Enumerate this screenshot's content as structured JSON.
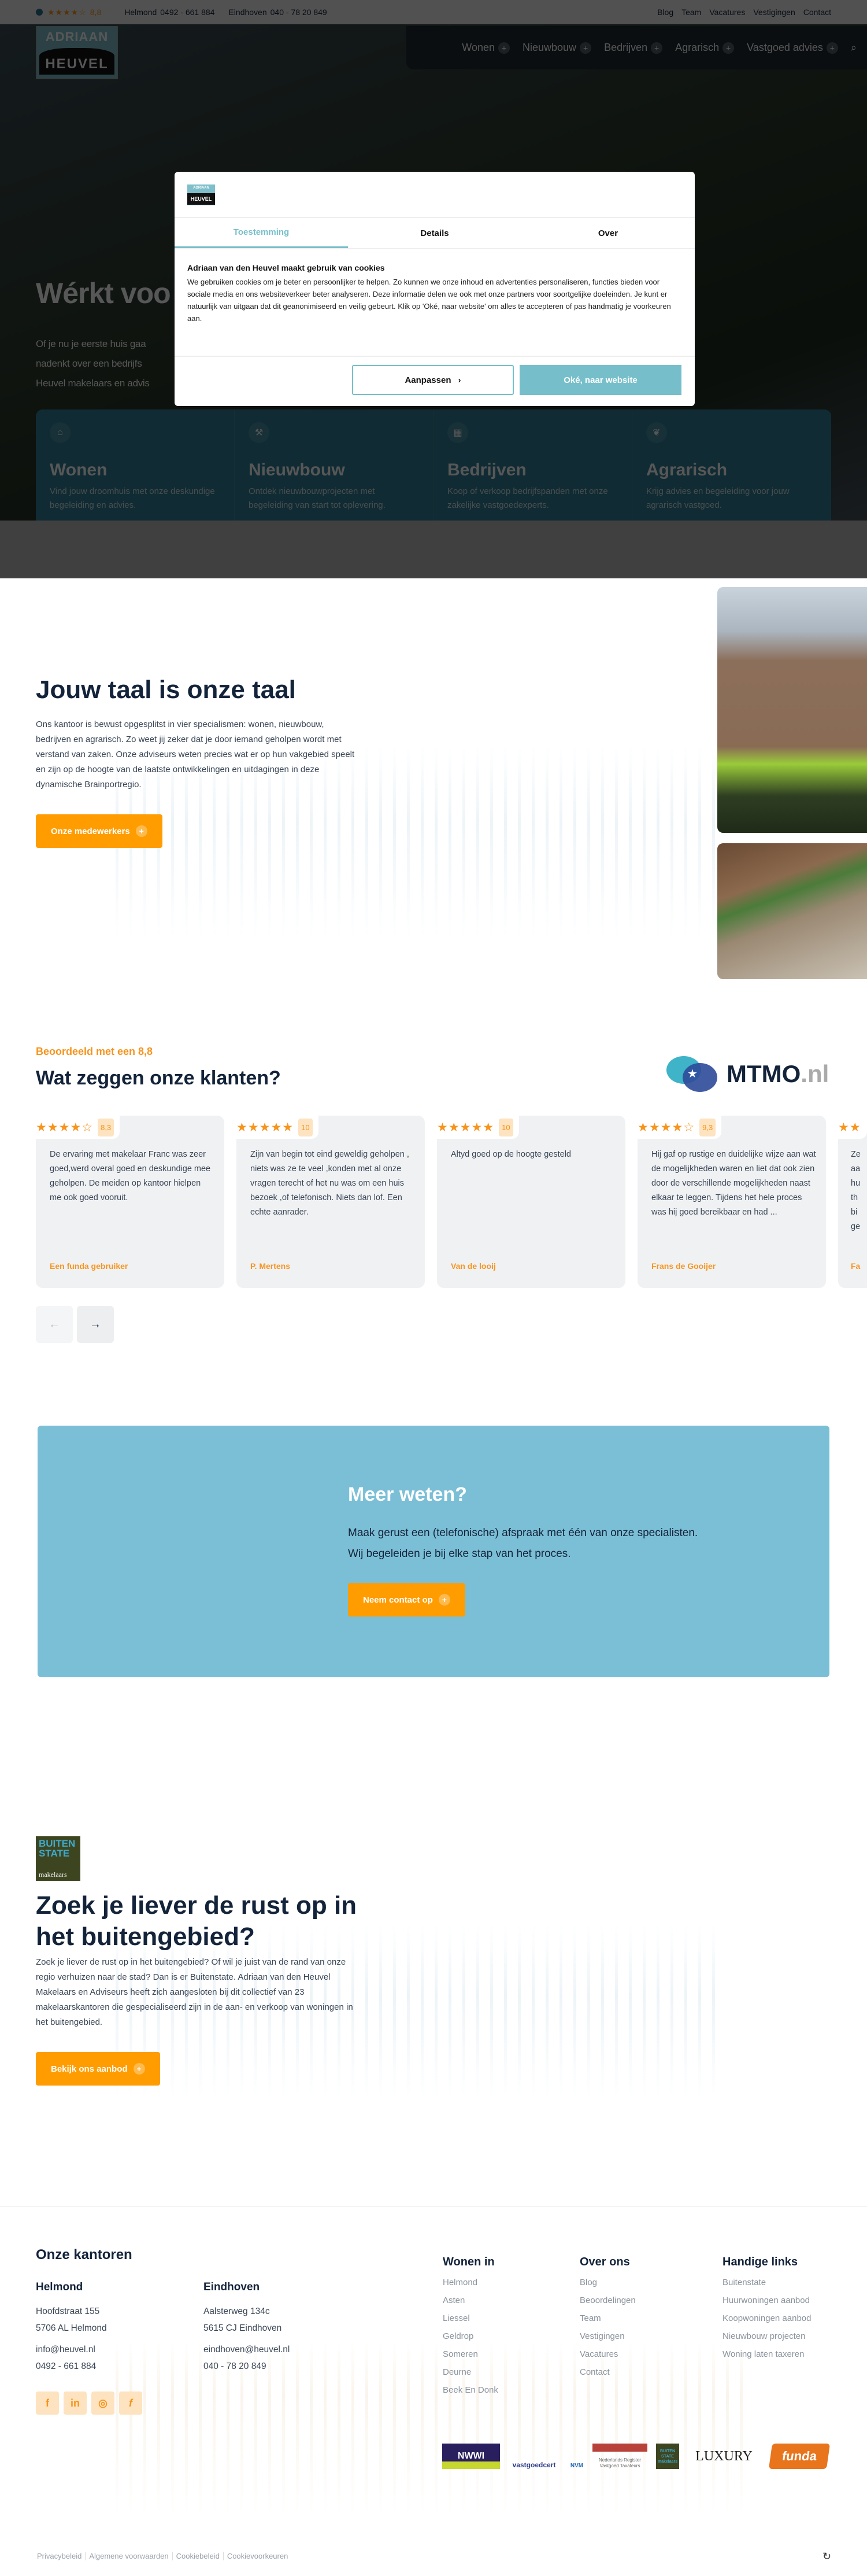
{
  "topbar": {
    "rating_stars": "★★★★☆",
    "rating_score": "8,8",
    "phones": [
      {
        "city": "Helmond",
        "number": "0492 - 661 884"
      },
      {
        "city": "Eindhoven",
        "number": "040 - 78 20 849"
      }
    ],
    "links": [
      "Blog",
      "Team",
      "Vacatures",
      "Vestigingen",
      "Contact"
    ]
  },
  "logo": {
    "top": "ADRIAAN",
    "bottom": "HEUVEL",
    "small": "VAN DEN"
  },
  "nav": {
    "items": [
      "Wonen",
      "Nieuwbouw",
      "Bedrijven",
      "Agrarisch",
      "Vastgoed advies"
    ],
    "plus": "+",
    "search_icon": "search-icon"
  },
  "hero": {
    "title_visible": "Wérkt voo",
    "text_lines_visible": [
      "Of je nu je eerste huis gaa",
      "nadenkt over een bedrijfs",
      "Heuvel makelaars en advis"
    ],
    "cards": [
      {
        "icon": "house-icon",
        "title": "Wonen",
        "text": "Vind jouw droomhuis met onze deskundige begeleiding en advies."
      },
      {
        "icon": "crane-icon",
        "title": "Nieuwbouw",
        "text": "Ontdek nieuwbouwprojecten met begeleiding van start tot oplevering."
      },
      {
        "icon": "office-icon",
        "title": "Bedrijven",
        "text": "Koop of verkoop bedrijfspanden met onze zakelijke vastgoedexperts."
      },
      {
        "icon": "leaf-icon",
        "title": "Agrarisch",
        "text": "Krijg advies en begeleiding voor jouw agrarisch vastgoed."
      }
    ]
  },
  "cookie_dialog": {
    "tabs": [
      "Toestemming",
      "Details",
      "Over"
    ],
    "active_tab": "Toestemming",
    "title": "Adriaan van den Heuvel maakt gebruik van cookies",
    "text": "We gebruiken cookies om je beter en persoonlijker te helpen. Zo kunnen we onze inhoud en advertenties personaliseren, functies bieden voor sociale media en ons websiteverkeer beter analyseren. Deze informatie delen we ook met onze partners voor soortgelijke doeleinden. Je kunt er natuurlijk van uitgaan dat dit geanonimiseerd en veilig gebeurt. Klik op 'Oké, naar website' om alles te accepteren of pas handmatig je voorkeuren aan.",
    "customize_label": "Aanpassen",
    "customize_chevron": "›",
    "accept_label": "Oké, naar website",
    "accent": "#76bfca"
  },
  "about": {
    "title": "Jouw taal is onze taal",
    "text": "Ons kantoor is bewust opgesplitst in vier specialismen: wonen, nieuwbouw, bedrijven en agrarisch. Zo weet jij zeker dat je door iemand geholpen wordt met verstand van zaken. Onze adviseurs weten precies wat er op hun vakgebied speelt en zijn op de hoogte van de laatste ontwikkelingen en uitdagingen in deze dynamische Brainportregio.",
    "button": "Onze medewerkers"
  },
  "reviews": {
    "eyebrow": "Beoordeeld met een 8,8",
    "title": "Wat zeggen onze klanten?",
    "provider": {
      "name": "MTMO",
      "suffix": ".nl"
    },
    "items": [
      {
        "stars": "★★★★☆",
        "score": "8,3",
        "text": "De ervaring met makelaar Franc was zeer goed,werd overal goed en deskundige mee geholpen. De meiden op kantoor hielpen me ook goed vooruit.",
        "author": "Een funda gebruiker"
      },
      {
        "stars": "★★★★★",
        "score": "10",
        "text": "Zijn van begin tot eind geweldig geholpen , niets was ze te veel ,konden met al onze vragen terecht of het nu was om een huis bezoek ,of telefonisch. Niets dan lof. Een echte aanrader.",
        "author": "P. Mertens"
      },
      {
        "stars": "★★★★★",
        "score": "10",
        "text": "Altyd goed op de hoogte gesteld",
        "author": "Van de looij"
      },
      {
        "stars": "★★★★☆",
        "score": "9,3",
        "text": "Hij gaf op rustige en duidelijke wijze aan wat de mogelijkheden waren en liet dat ook zien door de verschillende mogelijkheden naast elkaar te leggen. Tijdens het hele proces was hij goed bereikbaar en had ...",
        "author": "Frans de Gooijer"
      },
      {
        "stars": "★★",
        "score": "",
        "text": "Ze aa hu th bi ge",
        "author": "Fa"
      }
    ],
    "prev_icon": "←",
    "next_icon": "→",
    "star_color": "#f7941d"
  },
  "cta": {
    "title": "Meer weten?",
    "text_lines": [
      "Maak gerust een (telefonische) afspraak met één van onze specialisten.",
      "Wij begeleiden je bij elke stap van het proces."
    ],
    "button": "Neem contact op",
    "background": "#7bbfd7"
  },
  "buitenstate": {
    "logo": {
      "line1": "BUITEN",
      "line2": "STATE",
      "line3": "makelaars"
    },
    "title": "Zoek je liever de rust op in het buitengebied?",
    "text": "Zoek je liever de rust op in het buitengebied? Of wil je juist van de rand van onze regio verhuizen naar de stad? Dan is er Buitenstate. Adriaan van den Heuvel Makelaars en Adviseurs heeft zich aangesloten bij dit collectief van 23 makelaarskantoren die gespecialiseerd zijn in de aan- en verkoop van woningen in het buitengebied.",
    "button": "Bekijk ons aanbod"
  },
  "footer": {
    "offices_title": "Onze kantoren",
    "offices": [
      {
        "name": "Helmond",
        "street": "Hoofdstraat 155",
        "city": "5706 AL Helmond",
        "email": "info@heuvel.nl",
        "phone": "0492 - 661 884"
      },
      {
        "name": "Eindhoven",
        "street": "Aalsterweg 134c",
        "city": "5615 CJ Eindhoven",
        "email": "eindhoven@heuvel.nl",
        "phone": "040 - 78 20 849"
      }
    ],
    "social": [
      {
        "icon": "facebook-icon",
        "glyph": "f"
      },
      {
        "icon": "linkedin-icon",
        "glyph": "in"
      },
      {
        "icon": "instagram-icon",
        "glyph": "◎"
      },
      {
        "icon": "funda-icon",
        "glyph": "f"
      }
    ],
    "columns": [
      {
        "title": "Wonen in",
        "links": [
          "Helmond",
          "Asten",
          "Liessel",
          "Geldrop",
          "Someren",
          "Deurne",
          "Beek En Donk"
        ]
      },
      {
        "title": "Over ons",
        "links": [
          "Blog",
          "Beoordelingen",
          "Team",
          "Vestigingen",
          "Vacatures",
          "Contact"
        ]
      },
      {
        "title": "Handige links",
        "links": [
          "Buitenstate",
          "Huurwoningen aanbod",
          "Koopwoningen aanbod",
          "Nieuwbouw projecten",
          "Woning laten taxeren"
        ]
      }
    ],
    "partners": [
      "NWWI",
      "vastgoedcert",
      "NVM",
      "Nederlands Register Vastgoed Taxateurs",
      "BUITEN STATE makelaars",
      "LUXURY",
      "funda"
    ],
    "bottom_links": [
      "Privacybeleid",
      "Algemene voorwaarden",
      "Cookiebeleid",
      "Cookievoorkeuren"
    ]
  }
}
